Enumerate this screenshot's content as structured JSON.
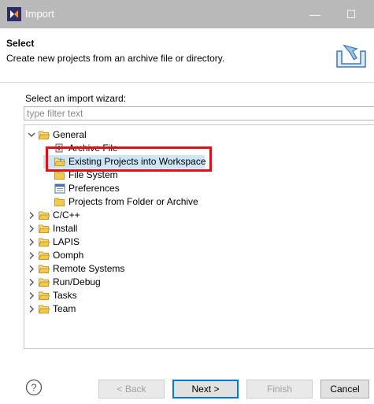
{
  "window": {
    "title": "Import",
    "minimize": "—",
    "maximize": "☐"
  },
  "header": {
    "title": "Select",
    "description": "Create new projects from an archive file or directory."
  },
  "wizard": {
    "label": "Select an import wizard:",
    "filter_placeholder": "type filter text"
  },
  "tree": {
    "general": "General",
    "children": [
      "Archive File",
      "Existing Projects into Workspace",
      "File System",
      "Preferences",
      "Projects from Folder or Archive"
    ],
    "categories": [
      "C/C++",
      "Install",
      "LAPIS",
      "Oomph",
      "Remote Systems",
      "Run/Debug",
      "Tasks",
      "Team"
    ]
  },
  "buttons": {
    "back": "< Back",
    "next": "Next >",
    "finish": "Finish",
    "cancel": "Cancel"
  },
  "colors": {
    "highlight": "#e0101a",
    "selection": "#cde6f7",
    "folder": "#f2c94c"
  }
}
